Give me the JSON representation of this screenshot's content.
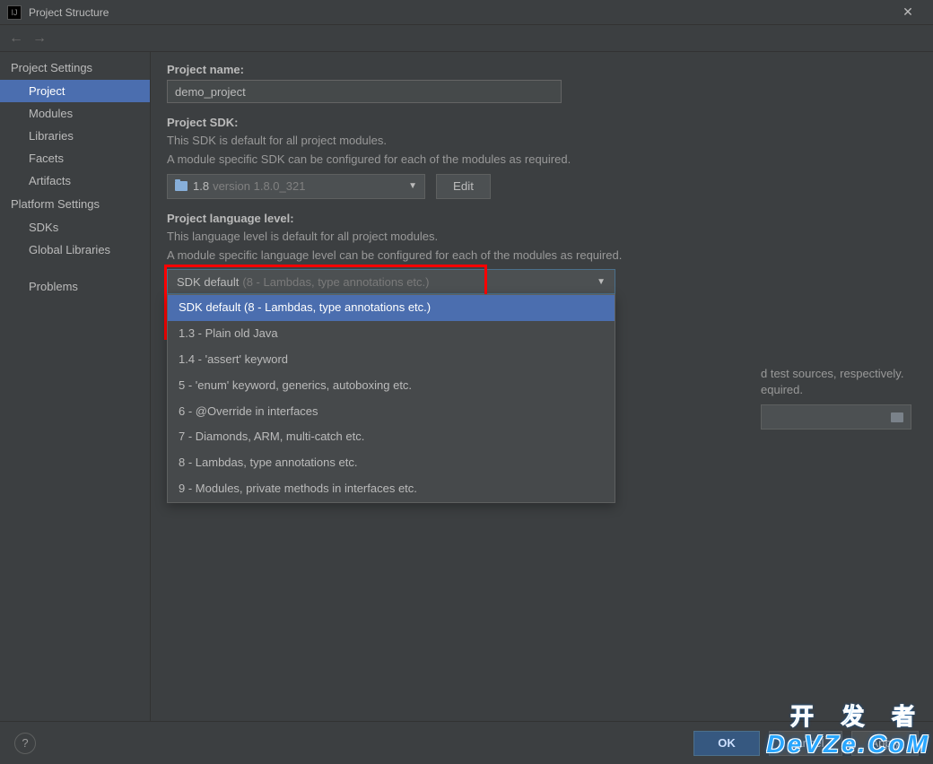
{
  "window": {
    "title": "Project Structure"
  },
  "sidebar": {
    "groups": [
      {
        "header": "Project Settings",
        "items": [
          "Project",
          "Modules",
          "Libraries",
          "Facets",
          "Artifacts"
        ],
        "selected": 0
      },
      {
        "header": "Platform Settings",
        "items": [
          "SDKs",
          "Global Libraries"
        ]
      },
      {
        "header": "",
        "items": [
          "Problems"
        ]
      }
    ]
  },
  "project": {
    "name_label": "Project name:",
    "name_value": "demo_project",
    "sdk_label": "Project SDK:",
    "sdk_desc1": "This SDK is default for all project modules.",
    "sdk_desc2": "A module specific SDK can be configured for each of the modules as required.",
    "sdk_value": "1.8",
    "sdk_version": "version 1.8.0_321",
    "edit_btn": "Edit",
    "lang_label": "Project language level:",
    "lang_desc1": "This language level is default for all project modules.",
    "lang_desc2": "A module specific language level can be configured for each of the modules as required.",
    "lang_value": "SDK default",
    "lang_hint": "(8 - Lambdas, type annotations etc.)",
    "lang_options": [
      "SDK default (8 - Lambdas, type annotations etc.)",
      "1.3 - Plain old Java",
      "1.4 - 'assert' keyword",
      "5 - 'enum' keyword, generics, autoboxing etc.",
      "6 - @Override in interfaces",
      "7 - Diamonds, ARM, multi-catch etc.",
      "8 - Lambdas, type annotations etc.",
      "9 - Modules, private methods in interfaces etc."
    ],
    "behind_right1": "d test sources, respectively.",
    "behind_right2": "equired."
  },
  "footer": {
    "ok": "OK",
    "cancel": "Cancel",
    "apply": "Apply"
  },
  "watermark": {
    "top": "开 发 者",
    "bottom": "DeVZe.CoM"
  }
}
